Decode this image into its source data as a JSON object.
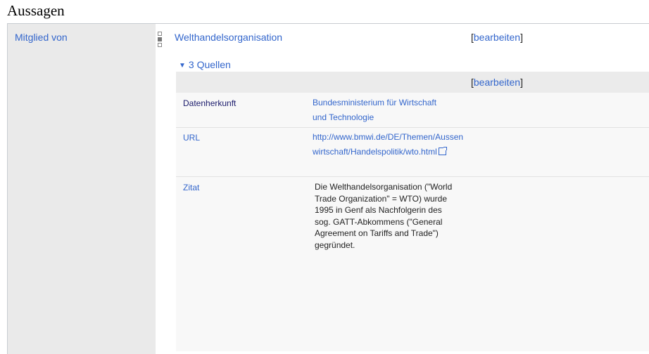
{
  "section": {
    "title": "Aussagen"
  },
  "statement": {
    "property": "Mitglied von",
    "value": "Welthandelsorganisation",
    "edit": {
      "open": "[",
      "label": "bearbeiten",
      "close": "]"
    }
  },
  "references": {
    "toggle_label": "3 Quellen",
    "edit": {
      "open": "[",
      "label": "bearbeiten",
      "close": "]"
    },
    "rows": [
      {
        "property": "Datenherkunft",
        "value_line1": "Bundesministerium für Wirtschaft",
        "value_line2": "und Technologie"
      },
      {
        "property": "URL",
        "value": "http://www.bmwi.de/DE/Themen/Aussenwirtschaft/Handelspolitik/wto.html"
      },
      {
        "property": "Zitat",
        "value": "Die Welthandelsorganisation (\"World Trade Organization\" = WTO) wurde 1995 in Genf als Nachfolgerin des sog. GATT-Abkommens (\"General Agreement on Tariffs and Trade\") gegründet."
      }
    ]
  },
  "colors": {
    "link": "#3366cc",
    "property_panel": "#eaeaea",
    "reference_bg": "#f8f8f8"
  }
}
